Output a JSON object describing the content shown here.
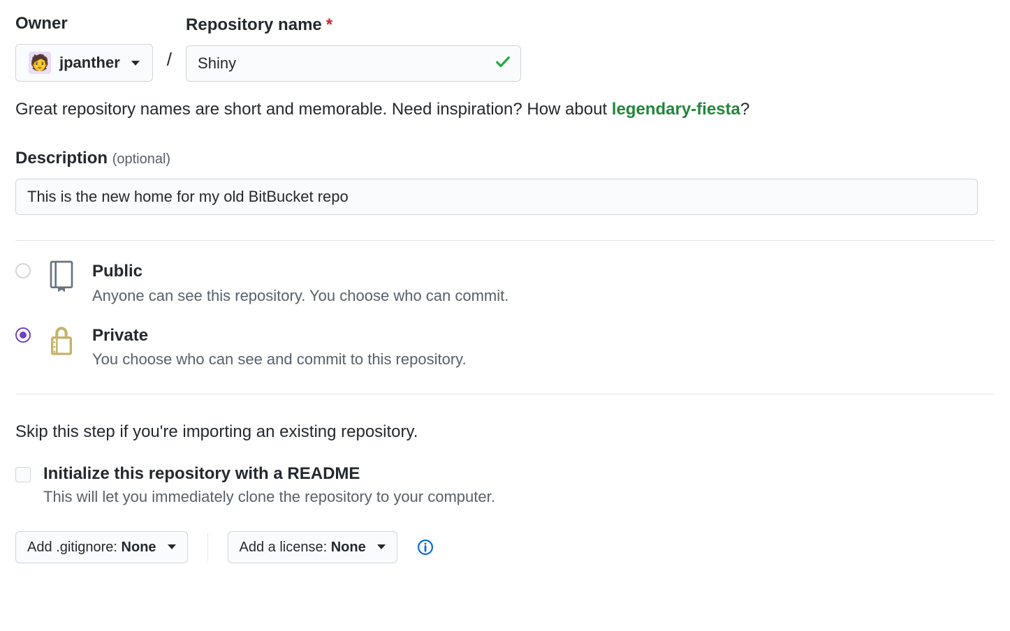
{
  "owner": {
    "label": "Owner",
    "username": "jpanther",
    "avatar_emoji": "🧑"
  },
  "repo": {
    "label": "Repository name",
    "value": "Shiny",
    "valid": true
  },
  "helper": {
    "prefix": "Great repository names are short and memorable. Need inspiration? How about ",
    "suggestion": "legendary-fiesta",
    "suffix": "?"
  },
  "description": {
    "label": "Description",
    "optional_label": "(optional)",
    "value": "This is the new home for my old BitBucket repo"
  },
  "visibility": {
    "public": {
      "title": "Public",
      "desc": "Anyone can see this repository. You choose who can commit."
    },
    "private": {
      "title": "Private",
      "desc": "You choose who can see and commit to this repository."
    },
    "selected": "private"
  },
  "init": {
    "skip_text": "Skip this step if you're importing an existing repository.",
    "readme_title": "Initialize this repository with a README",
    "readme_desc": "This will let you immediately clone the repository to your computer."
  },
  "dropdowns": {
    "gitignore_prefix": "Add .gitignore: ",
    "gitignore_value": "None",
    "license_prefix": "Add a license: ",
    "license_value": "None"
  }
}
